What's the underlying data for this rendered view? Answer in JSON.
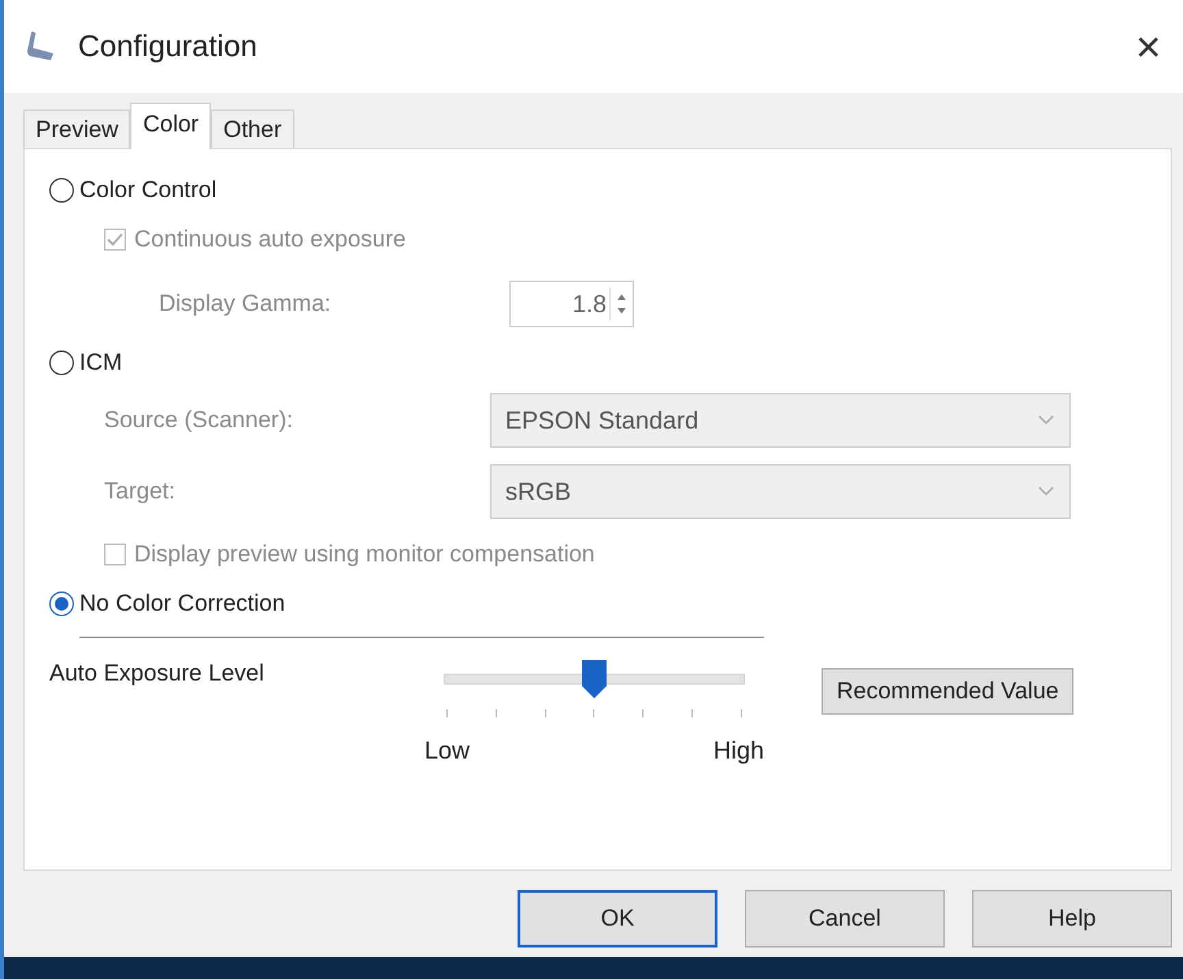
{
  "window": {
    "title": "Configuration",
    "close": "×"
  },
  "tabs": [
    {
      "label": "Preview",
      "selected": false
    },
    {
      "label": "Color",
      "selected": true
    },
    {
      "label": "Other",
      "selected": false
    }
  ],
  "modes": [
    {
      "label": "Color Control",
      "selected": false,
      "settings": [
        {
          "kind": "checkbox",
          "label": "Continuous auto exposure",
          "checked": true,
          "disabled": true
        },
        {
          "kind": "spin",
          "label": "Display Gamma:",
          "value": "1.8",
          "disabled": true
        }
      ]
    },
    {
      "label": "ICM",
      "selected": false,
      "settings": [
        {
          "kind": "select",
          "label": "Source (Scanner):",
          "value": "EPSON Standard",
          "disabled": true
        },
        {
          "kind": "select",
          "label": "Target:",
          "value": "sRGB",
          "disabled": true
        },
        {
          "kind": "checkbox",
          "label": "Display preview using monitor compensation",
          "checked": false,
          "disabled": true
        }
      ]
    },
    {
      "label": "No Color Correction",
      "selected": true
    }
  ],
  "exposure": {
    "label": "Auto Exposure Level",
    "level": 0.5,
    "low": "Low",
    "high": "High",
    "button": "Recommended Value"
  },
  "buttons": [
    {
      "label": "OK",
      "default": true
    },
    {
      "label": "Cancel",
      "default": false
    },
    {
      "label": "Help",
      "default": false
    }
  ]
}
